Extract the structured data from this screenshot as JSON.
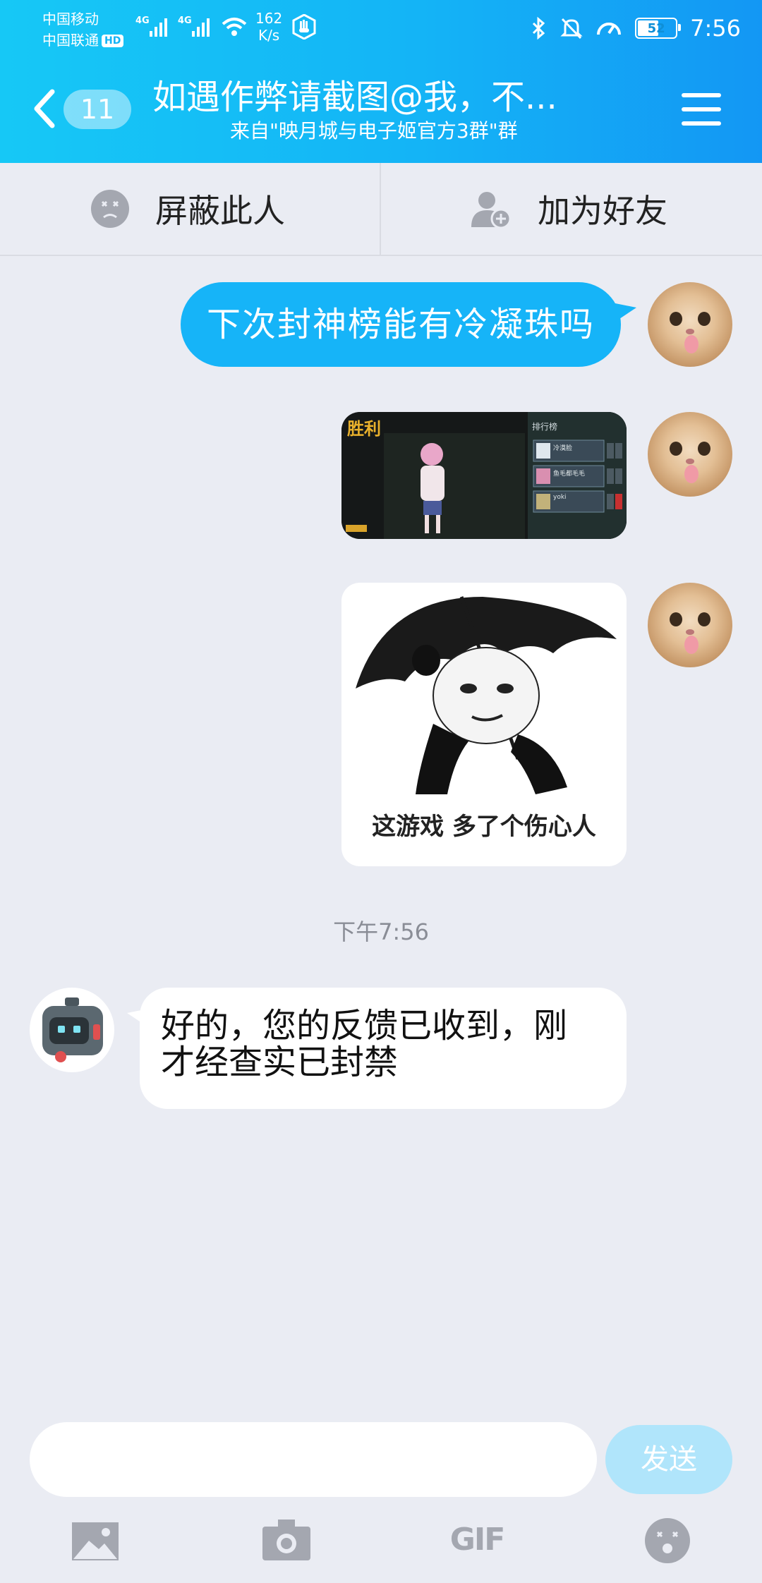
{
  "status_bar": {
    "carrier_1": "中国移动",
    "carrier_2": "中国联通",
    "hd_badge": "HD",
    "network_1": "4G",
    "network_2": "4G",
    "speed_value": "162",
    "speed_unit": "K/s",
    "battery": "52",
    "time": "7:56"
  },
  "header": {
    "unread_count": "11",
    "title": "如遇作弊请截图@我，不...",
    "subtitle": "来自\"映月城与电子姬官方3群\"群"
  },
  "action_bar": {
    "block_label": "屏蔽此人",
    "add_friend_label": "加为好友"
  },
  "messages": {
    "sent_text": "下次封神榜能有冷凝珠吗",
    "screenshot": {
      "victory_label": "胜利",
      "leaderboard_title": "排行榜",
      "players": [
        "冷漠脸",
        "鱼毛都毛毛",
        "yoki"
      ]
    },
    "sticker_caption": "这游戏 多了个伤心人",
    "timestamp": "下午7:56",
    "reply_line1": "好的，您的反馈已收到，刚",
    "reply_line2": "才经查实已封禁"
  },
  "input": {
    "value": "",
    "send_label": "发送"
  },
  "toolbar": {
    "icons": [
      "image-icon",
      "camera-icon",
      "gif-icon",
      "emoji-icon"
    ],
    "gif_label": "GIF"
  },
  "colors": {
    "accent": "#16b4f8",
    "header_gradient_start": "#16c8f6",
    "header_gradient_end": "#1397f4",
    "chat_background": "#eaecf3",
    "send_disabled": "#b0e5fb"
  }
}
